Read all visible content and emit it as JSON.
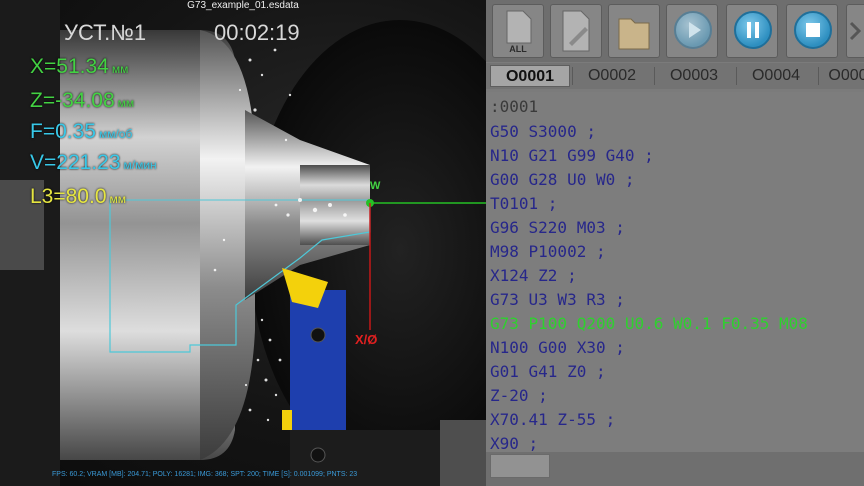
{
  "viewport": {
    "file_title": "G73_example_01.esdata",
    "station": "УСТ.№1",
    "timer": "00:02:19",
    "readouts": [
      {
        "label": "X=51.34",
        "unit": "мм"
      },
      {
        "label": "Z=-34.08",
        "unit": "мм"
      },
      {
        "label": "F=0.35",
        "unit": "мм/об"
      },
      {
        "label": "V=221.23",
        "unit": "м/мин"
      },
      {
        "label": "L3=80.0",
        "unit": "мм"
      }
    ],
    "axis_w_label": "W",
    "axis_x_label": "X/Ø",
    "status_line": "FPS: 60.2; VRAM [MB]: 204.71; POLY: 16281; IMG: 368; SPT: 200; TIME [S]: 0.001099; PNTS: 23"
  },
  "toolbar": {
    "all_label": "ALL",
    "buttons": [
      "all-programs",
      "edit",
      "folder",
      "play",
      "pause",
      "stop"
    ]
  },
  "tabs": [
    "O0001",
    "O0002",
    "O0003",
    "O0004",
    "O000"
  ],
  "active_tab": "O0001",
  "program": {
    "header": ":0001",
    "lines": [
      "G50 S3000 ;",
      "N10 G21 G99 G40 ;",
      "G00 G28 U0 W0 ;",
      "T0101 ;",
      "G96 S220 M03 ;",
      "M98 P10002 ;",
      "X124 Z2 ;",
      "G73 U3 W3 R3 ;",
      "G73 P100 Q200 U0.6 W0.1 F0.35 M08",
      "N100 G00 X30 ;",
      "G01 G41 Z0 ;",
      "Z-20 ;",
      "X70.41 Z-55 ;",
      "X90 ;"
    ],
    "current_line_index": 8
  },
  "colors": {
    "code_text": "#27278a",
    "current_line": "#2ed12e",
    "readout_green": "#43d243",
    "readout_cyan": "#38c8e8",
    "readout_yellow": "#e6e641"
  }
}
